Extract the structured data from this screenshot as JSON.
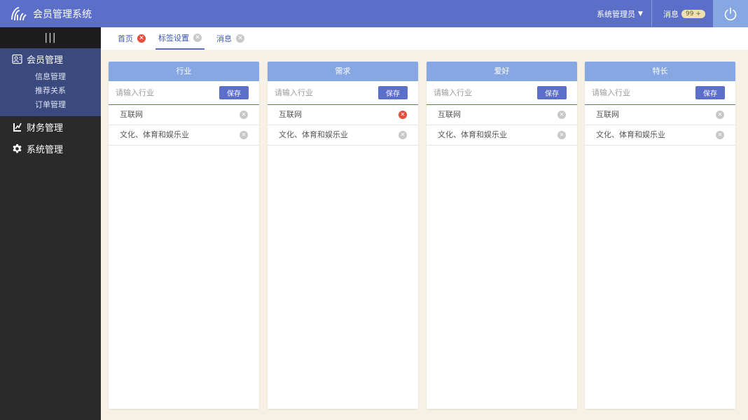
{
  "header": {
    "app_title": "会员管理系统",
    "user_label": "系统管理员",
    "msg_label": "消息",
    "msg_badge": "99 +",
    "logo_icon": "logo-icon",
    "power_icon": "power-icon"
  },
  "sidebar": {
    "collapse_icon": "menu-bars-icon",
    "groups": [
      {
        "label": "会员管理",
        "icon": "member-icon",
        "children": [
          "信息管理",
          "推荐关系",
          "订单管理"
        ]
      },
      {
        "label": "财务管理",
        "icon": "finance-icon"
      },
      {
        "label": "系统管理",
        "icon": "gear-icon"
      }
    ]
  },
  "tabs": [
    {
      "label": "首页",
      "close": "red"
    },
    {
      "label": "标签设置",
      "close": "grey",
      "active": true
    },
    {
      "label": "消息",
      "close": "grey"
    }
  ],
  "panels": [
    {
      "title": "行业",
      "placeholder": "请输入行业",
      "save": "保存",
      "items": [
        {
          "text": "互联网",
          "remove": "grey"
        },
        {
          "text": "文化、体育和娱乐业",
          "remove": "grey"
        }
      ]
    },
    {
      "title": "需求",
      "placeholder": "请输入行业",
      "save": "保存",
      "items": [
        {
          "text": "互联网",
          "remove": "red"
        },
        {
          "text": "文化、体育和娱乐业",
          "remove": "grey"
        }
      ]
    },
    {
      "title": "爱好",
      "placeholder": "请输入行业",
      "save": "保存",
      "items": [
        {
          "text": "互联网",
          "remove": "grey"
        },
        {
          "text": "文化、体育和娱乐业",
          "remove": "grey"
        }
      ]
    },
    {
      "title": "特长",
      "placeholder": "请输入行业",
      "save": "保存",
      "items": [
        {
          "text": "互联网",
          "remove": "grey"
        },
        {
          "text": "文化、体育和娱乐业",
          "remove": "grey"
        }
      ]
    }
  ],
  "colors": {
    "header": "#5b6fc8",
    "panel_head": "#86a7e2",
    "sidebar": "#2a2a2a",
    "sidebar_active": "#3a4a7e",
    "background": "#f7f0e4",
    "close_red": "#e74c3c"
  }
}
